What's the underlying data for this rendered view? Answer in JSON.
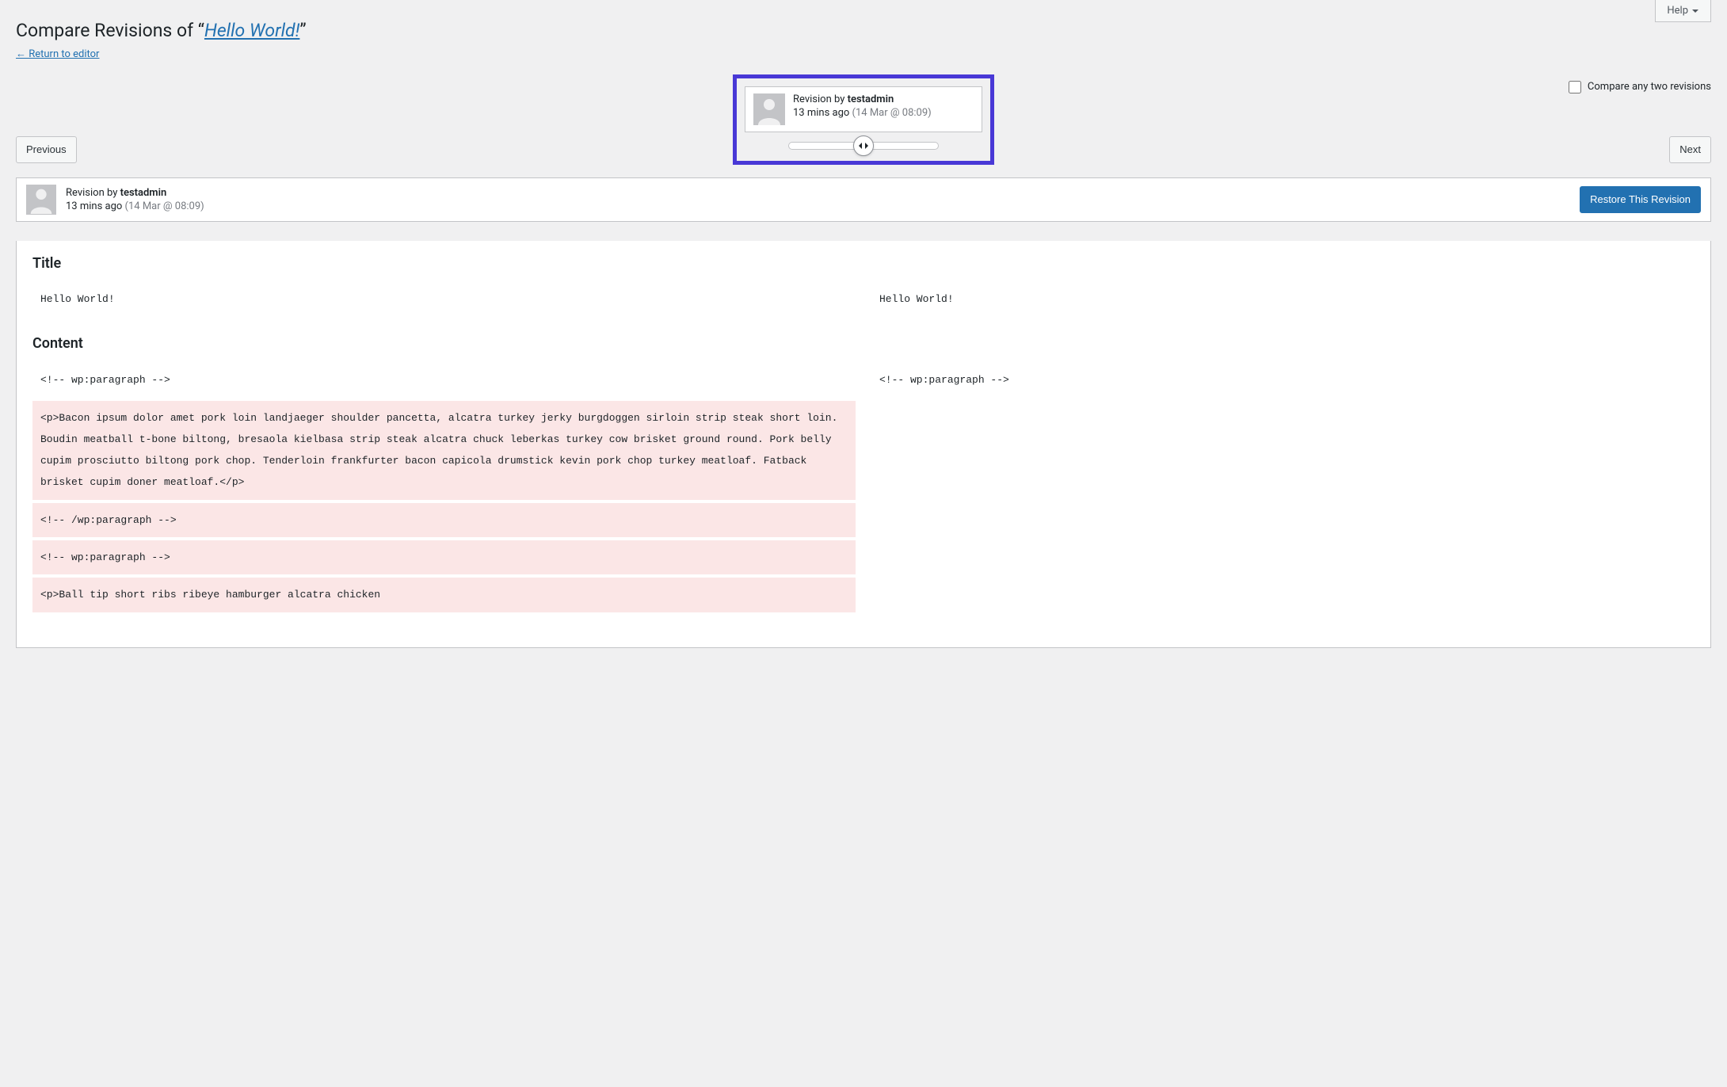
{
  "help": {
    "label": "Help"
  },
  "header": {
    "prefix": "Compare Revisions of “",
    "link_text": "Hello World!",
    "suffix": "”",
    "return_link": "← Return to editor"
  },
  "controls": {
    "previous": "Previous",
    "next": "Next",
    "compare_label": "Compare any two revisions"
  },
  "tooltip": {
    "by_label": "Revision by ",
    "author": "testadmin",
    "ago": "13 mins ago",
    "timestamp": "(14 Mar @ 08:09)"
  },
  "meta_bar": {
    "by_label": "Revision by ",
    "author": "testadmin",
    "ago": "13 mins ago",
    "timestamp": "(14 Mar @ 08:09)",
    "restore": "Restore This Revision"
  },
  "diff": {
    "title_heading": "Title",
    "content_heading": "Content",
    "title_left": "Hello World!",
    "title_right": "Hello World!",
    "content_left": [
      {
        "type": "context",
        "text": "<!-- wp:paragraph -->"
      },
      {
        "type": "removed",
        "text": "<p>Bacon ipsum dolor amet pork loin landjaeger shoulder pancetta, alcatra turkey jerky burgdoggen sirloin strip steak short loin. Boudin meatball t-bone biltong, bresaola kielbasa strip steak alcatra chuck leberkas turkey cow brisket ground round. Pork belly cupim prosciutto biltong pork chop. Tenderloin frankfurter bacon capicola drumstick kevin pork chop turkey meatloaf. Fatback brisket cupim doner meatloaf.</p>"
      },
      {
        "type": "removed",
        "text": "<!-- /wp:paragraph -->"
      },
      {
        "type": "removed",
        "text": "<!-- wp:paragraph -->"
      },
      {
        "type": "removed",
        "text": "<p>Ball tip short ribs ribeye hamburger alcatra chicken"
      }
    ],
    "content_right": [
      {
        "type": "context",
        "text": "<!-- wp:paragraph -->"
      }
    ]
  }
}
